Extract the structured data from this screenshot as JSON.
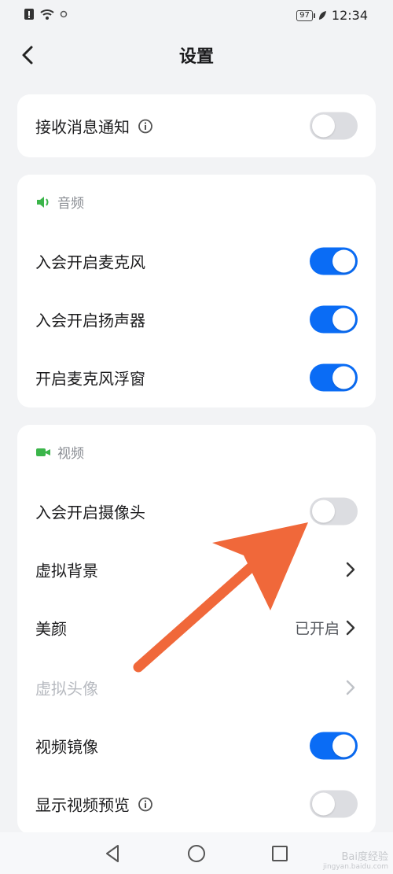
{
  "status_bar": {
    "battery": "97",
    "time": "12:34"
  },
  "header": {
    "title": "设置"
  },
  "card_notify": {
    "label": "接收消息通知",
    "on": false
  },
  "audio": {
    "section_title": "音频",
    "items": [
      {
        "label": "入会开启麦克风",
        "on": true
      },
      {
        "label": "入会开启扬声器",
        "on": true
      },
      {
        "label": "开启麦克风浮窗",
        "on": true
      }
    ]
  },
  "video": {
    "section_title": "视频",
    "camera": {
      "label": "入会开启摄像头",
      "on": false
    },
    "virtual_bg": {
      "label": "虚拟背景"
    },
    "beauty": {
      "label": "美颜",
      "value": "已开启"
    },
    "virtual_avatar": {
      "label": "虚拟头像"
    },
    "mirror": {
      "label": "视频镜像",
      "on": true
    },
    "preview": {
      "label": "显示视频预览",
      "on": false
    }
  },
  "watermark": {
    "text": "Bai度经验",
    "sub": "jingyan.baidu.com"
  },
  "colors": {
    "accent": "#0a6cf5",
    "green": "#3bb54a",
    "arrow": "#f0683a"
  }
}
